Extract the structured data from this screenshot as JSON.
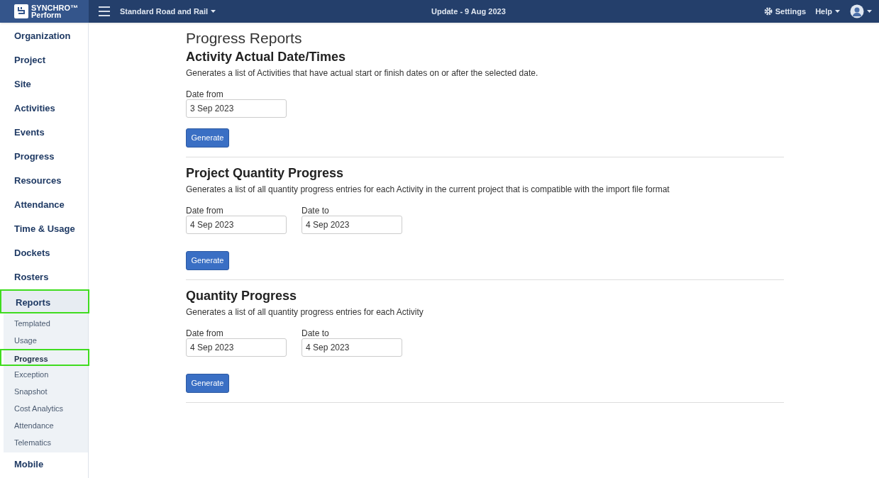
{
  "header": {
    "logo_line1": "SYNCHRO",
    "logo_mark": "™",
    "logo_line2": "Perform",
    "project": "Standard Road and Rail",
    "update": "Update - 9 Aug 2023",
    "settings": "Settings",
    "help": "Help"
  },
  "sidebar": {
    "items": [
      {
        "label": "Organization",
        "selected": false,
        "highlighted": false
      },
      {
        "label": "Project",
        "selected": false,
        "highlighted": false
      },
      {
        "label": "Site",
        "selected": false,
        "highlighted": false
      },
      {
        "label": "Activities",
        "selected": false,
        "highlighted": false
      },
      {
        "label": "Events",
        "selected": false,
        "highlighted": false
      },
      {
        "label": "Progress",
        "selected": false,
        "highlighted": false
      },
      {
        "label": "Resources",
        "selected": false,
        "highlighted": false
      },
      {
        "label": "Attendance",
        "selected": false,
        "highlighted": false
      },
      {
        "label": "Time & Usage",
        "selected": false,
        "highlighted": false
      },
      {
        "label": "Dockets",
        "selected": false,
        "highlighted": false
      },
      {
        "label": "Rosters",
        "selected": false,
        "highlighted": false
      },
      {
        "label": "Reports",
        "selected": true,
        "highlighted": true,
        "children": [
          {
            "label": "Templated",
            "selected": false,
            "highlighted": false
          },
          {
            "label": "Usage",
            "selected": false,
            "highlighted": false
          },
          {
            "label": "Progress",
            "selected": true,
            "highlighted": true
          },
          {
            "label": "Exception",
            "selected": false,
            "highlighted": false
          },
          {
            "label": "Snapshot",
            "selected": false,
            "highlighted": false
          },
          {
            "label": "Cost Analytics",
            "selected": false,
            "highlighted": false
          },
          {
            "label": "Attendance",
            "selected": false,
            "highlighted": false
          },
          {
            "label": "Telematics",
            "selected": false,
            "highlighted": false
          }
        ]
      },
      {
        "label": "Mobile",
        "selected": false,
        "highlighted": false
      }
    ]
  },
  "page_title": "Progress Reports",
  "sections": [
    {
      "title": "Activity Actual Date/Times",
      "description": "Generates a list of Activities that have actual start or finish dates on or after the selected date.",
      "fields": [
        {
          "label": "Date from",
          "value": "3 Sep 2023"
        }
      ],
      "button": "Generate"
    },
    {
      "title": "Project Quantity Progress",
      "description": "Generates a list of all quantity progress entries for each Activity in the current project that is compatible with the import file format",
      "fields": [
        {
          "label": "Date from",
          "value": "4 Sep 2023"
        },
        {
          "label": "Date to",
          "value": "4 Sep 2023"
        }
      ],
      "button": "Generate"
    },
    {
      "title": "Quantity Progress",
      "description": "Generates a list of all quantity progress entries for each Activity",
      "fields": [
        {
          "label": "Date from",
          "value": "4 Sep 2023"
        },
        {
          "label": "Date to",
          "value": "4 Sep 2023"
        }
      ],
      "button": "Generate"
    }
  ]
}
